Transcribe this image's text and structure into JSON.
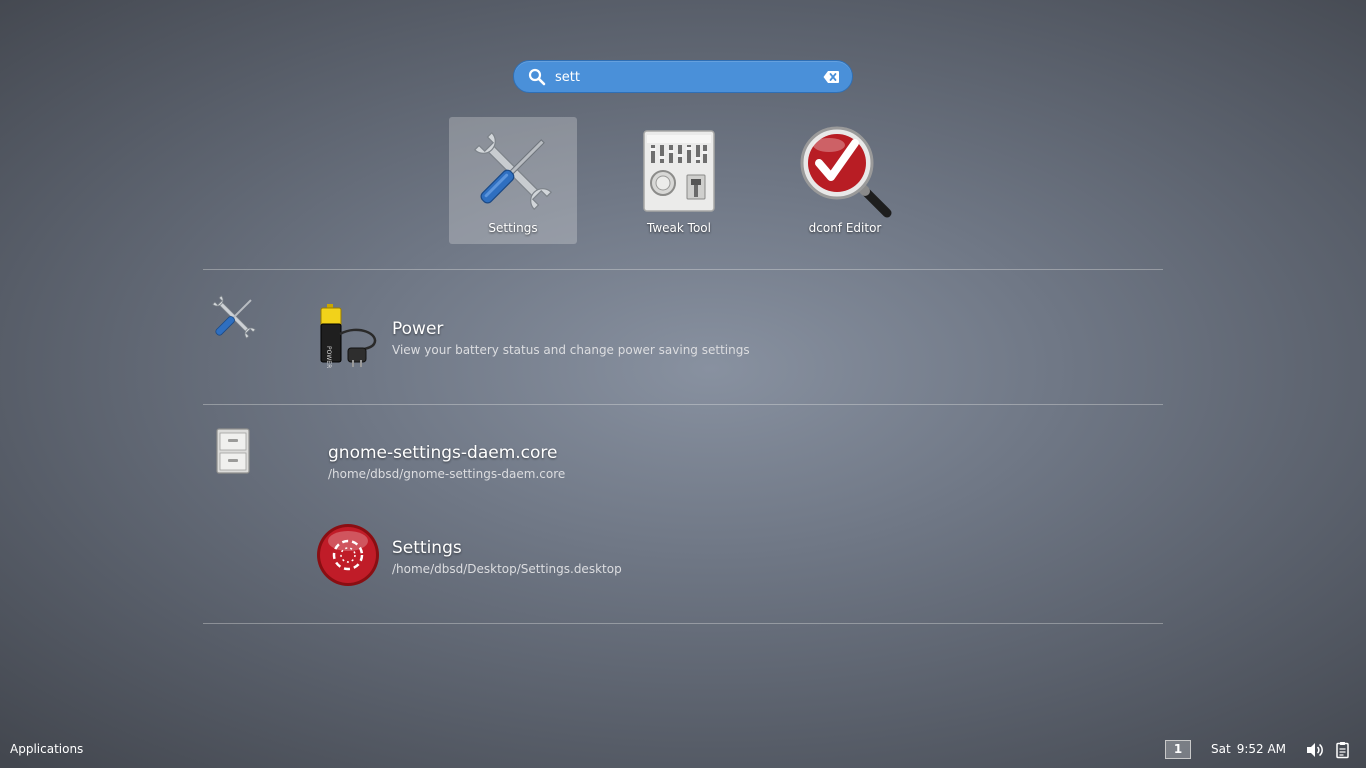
{
  "search": {
    "value": "sett",
    "placeholder": ""
  },
  "app_grid": [
    {
      "label": "Settings",
      "icon": "settings-icon",
      "selected": true
    },
    {
      "label": "Tweak Tool",
      "icon": "tweak-tool-icon",
      "selected": false
    },
    {
      "label": "dconf Editor",
      "icon": "dconf-editor-icon",
      "selected": false
    }
  ],
  "providers": [
    {
      "icon": "settings-provider-icon",
      "results": [
        {
          "title": "Power",
          "description": "View your battery status and change power saving settings",
          "icon": "power-battery-icon"
        }
      ]
    },
    {
      "icon": "files-provider-icon",
      "results": [
        {
          "title": "gnome-settings-daem.core",
          "description": "/home/dbsd/gnome-settings-daem.core",
          "icon": ""
        },
        {
          "title": "Settings",
          "description": "/home/dbsd/Desktop/Settings.desktop",
          "icon": "desktop-file-icon"
        }
      ]
    }
  ],
  "bottom_bar": {
    "applications_label": "Applications",
    "workspace": "1",
    "day": "Sat",
    "time": "9:52 AM"
  },
  "colors": {
    "search_bg": "#4a90d9",
    "selected_tile": "#9da3ad",
    "accent_red": "#c01c28"
  }
}
